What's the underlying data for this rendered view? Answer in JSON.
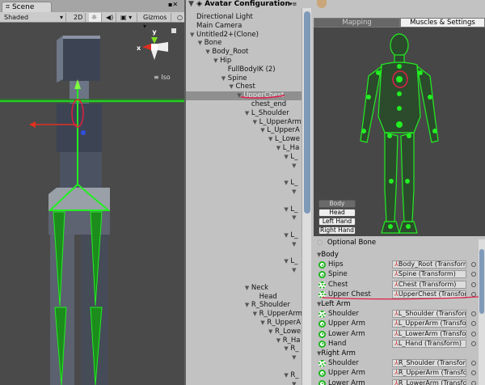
{
  "scene": {
    "tab": "Scene",
    "shading": "Shaded",
    "mode_2d": "2D",
    "gizmos": "Gizmos",
    "projection": "Iso",
    "axis_y": "y",
    "axis_x": "x"
  },
  "hierarchy": {
    "title": "Avatar Configuration",
    "rows": [
      {
        "t": "Directional Light",
        "l": 0,
        "a": false
      },
      {
        "t": "Main Camera",
        "l": 0,
        "a": false
      },
      {
        "t": "Untitled2+(Clone)",
        "l": 0,
        "a": true
      },
      {
        "t": "Bone",
        "l": 1,
        "a": true
      },
      {
        "t": "Body_Root",
        "l": 2,
        "a": true
      },
      {
        "t": "Hip",
        "l": 3,
        "a": true
      },
      {
        "t": "FullBodyIK (2)",
        "l": 4,
        "a": false
      },
      {
        "t": "Spine",
        "l": 4,
        "a": true
      },
      {
        "t": "Chest",
        "l": 5,
        "a": true
      },
      {
        "t": "UpperChest",
        "l": 6,
        "a": true,
        "sel": true
      },
      {
        "t": "chest_end",
        "l": 7,
        "a": false
      },
      {
        "t": "L_Shoulder",
        "l": 7,
        "a": true
      },
      {
        "t": "L_UpperArm",
        "l": 8,
        "a": true
      },
      {
        "t": "L_UpperA",
        "l": 9,
        "a": true
      },
      {
        "t": "L_Lowe",
        "l": 10,
        "a": true
      },
      {
        "t": "L_Ha",
        "l": 11,
        "a": true
      },
      {
        "t": "L_",
        "l": 12,
        "a": true
      },
      {
        "t": "",
        "l": 13,
        "a": true
      },
      {
        "t": "",
        "l": 0,
        "a": false
      },
      {
        "t": "L_",
        "l": 12,
        "a": true
      },
      {
        "t": "",
        "l": 13,
        "a": true
      },
      {
        "t": "",
        "l": 0,
        "a": false
      },
      {
        "t": "L_",
        "l": 12,
        "a": true
      },
      {
        "t": "",
        "l": 13,
        "a": true
      },
      {
        "t": "",
        "l": 0,
        "a": false
      },
      {
        "t": "L_",
        "l": 12,
        "a": true
      },
      {
        "t": "",
        "l": 13,
        "a": true
      },
      {
        "t": "",
        "l": 0,
        "a": false
      },
      {
        "t": "L_",
        "l": 12,
        "a": true
      },
      {
        "t": "",
        "l": 13,
        "a": true
      },
      {
        "t": "",
        "l": 0,
        "a": false
      },
      {
        "t": "Neck",
        "l": 7,
        "a": true
      },
      {
        "t": "Head",
        "l": 8,
        "a": false
      },
      {
        "t": "R_Shoulder",
        "l": 7,
        "a": true
      },
      {
        "t": "R_UpperArm",
        "l": 8,
        "a": true
      },
      {
        "t": "R_UpperA",
        "l": 9,
        "a": true
      },
      {
        "t": "R_Lowe",
        "l": 10,
        "a": true
      },
      {
        "t": "R_Ha",
        "l": 11,
        "a": true
      },
      {
        "t": "R_",
        "l": 12,
        "a": true
      },
      {
        "t": "",
        "l": 13,
        "a": true
      },
      {
        "t": "",
        "l": 0,
        "a": false
      },
      {
        "t": "R_",
        "l": 12,
        "a": true
      },
      {
        "t": "",
        "l": 13,
        "a": true
      }
    ]
  },
  "inspector": {
    "tabs": [
      "Mapping",
      "Muscles & Settings"
    ],
    "parts": [
      "Body",
      "Head",
      "Left Hand",
      "Right Hand"
    ],
    "optional": "Optional Bone",
    "sections": [
      {
        "name": "Body",
        "rows": [
          {
            "l": "Hips",
            "v": "Body_Root (Transform)",
            "o": false
          },
          {
            "l": "Spine",
            "v": "Spine (Transform)",
            "o": false
          },
          {
            "l": "Chest",
            "v": "Chest (Transform)",
            "o": true
          },
          {
            "l": "Upper Chest",
            "v": "UpperChest (Transform)",
            "o": true
          }
        ]
      },
      {
        "name": "Left Arm",
        "rows": [
          {
            "l": "Shoulder",
            "v": "L_Shoulder (Transform)",
            "o": true
          },
          {
            "l": "Upper Arm",
            "v": "L_UpperArm (Transform)",
            "o": false
          },
          {
            "l": "Lower Arm",
            "v": "L_LowerArm (Transform)",
            "o": false
          },
          {
            "l": "Hand",
            "v": "L_Hand (Transform)",
            "o": false
          }
        ]
      },
      {
        "name": "Right Arm",
        "rows": [
          {
            "l": "Shoulder",
            "v": "R_Shoulder (Transform)",
            "o": true
          },
          {
            "l": "Upper Arm",
            "v": "R_UpperArm (Transform)",
            "o": false
          },
          {
            "l": "Lower Arm",
            "v": "R_LowerArm (Transform)",
            "o": false
          }
        ]
      }
    ]
  },
  "colors": {
    "bone": "#22ee22",
    "annotation": "#e0204a",
    "selection": "#8f8f8f"
  }
}
